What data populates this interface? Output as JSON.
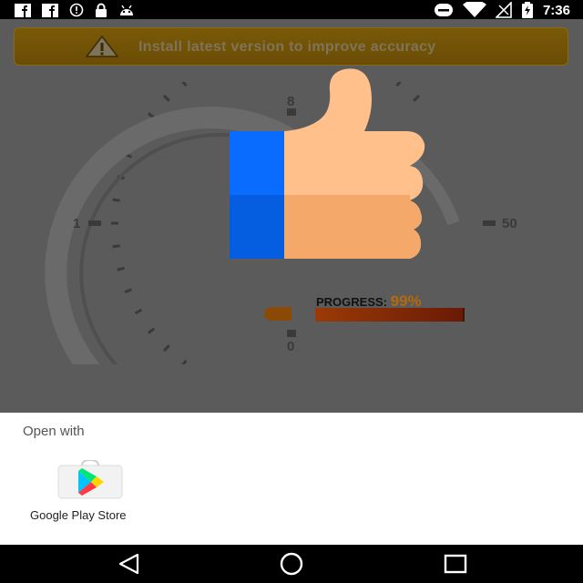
{
  "status_bar": {
    "time": "7:36",
    "icons": [
      "facebook-icon",
      "facebook-icon",
      "alert-circle-icon",
      "lock-icon",
      "android-icon",
      "do-not-disturb-icon",
      "wifi-icon",
      "signal-icon",
      "battery-charging-icon"
    ]
  },
  "banner": {
    "text": "Install latest version to improve accuracy",
    "icon": "warning-icon"
  },
  "gauge": {
    "tick_labels": {
      "top": "8",
      "left": "1",
      "right": "50",
      "bottom": "0"
    },
    "progress_label": "PROGRESS:",
    "progress_value": "99%",
    "progress": 0.99
  },
  "overlay": {
    "icon": "thumbs-up-icon"
  },
  "sheet": {
    "title": "Open with",
    "apps": [
      {
        "label": "Google Play Store",
        "icon": "google-play-store-icon"
      }
    ]
  },
  "nav_bar": {
    "buttons": [
      "back-icon",
      "home-icon",
      "recents-icon"
    ]
  }
}
